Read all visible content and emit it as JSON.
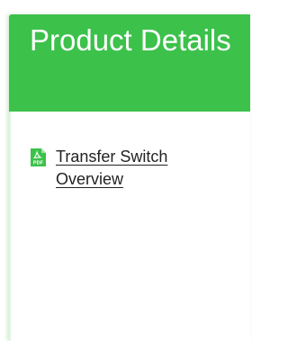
{
  "header": {
    "title": "Product Details"
  },
  "documents": [
    {
      "label": "Transfer Switch Overview",
      "icon": "pdf-file-icon",
      "icon_text": "PDF"
    }
  ],
  "colors": {
    "header_bg": "#3cc14b",
    "header_text": "#ffffff",
    "pdf_icon": "#3cc14b",
    "link_text": "#222222"
  }
}
